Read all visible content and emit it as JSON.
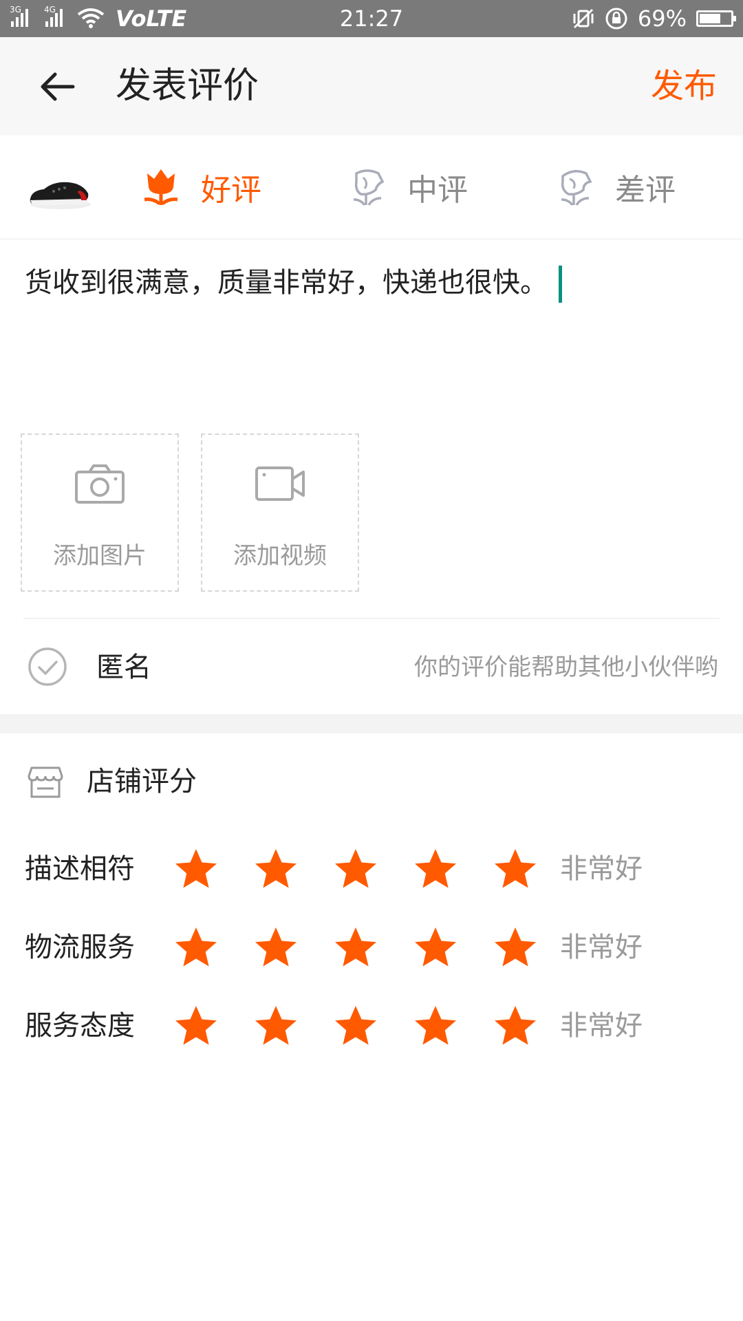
{
  "status_bar": {
    "net1": "3G",
    "net2": "4G",
    "volte": "VoLTE",
    "time": "21:27",
    "battery": "69%",
    "battery_level": 0.69
  },
  "header": {
    "title": "发表评价",
    "publish_label": "发布"
  },
  "rating_types": [
    {
      "label": "好评",
      "icon": "flower-icon",
      "selected": true
    },
    {
      "label": "中评",
      "icon": "neutral-flower-icon",
      "selected": false
    },
    {
      "label": "差评",
      "icon": "sad-flower-icon",
      "selected": false
    }
  ],
  "review": {
    "text": "货收到很满意，质量非常好，快递也很快。"
  },
  "uploads": {
    "photo_label": "添加图片",
    "video_label": "添加视频"
  },
  "anonymous": {
    "label": "匿名",
    "hint": "你的评价能帮助其他小伙伴哟"
  },
  "shop_rating": {
    "title": "店铺评分",
    "rows": [
      {
        "label": "描述相符",
        "stars": 5,
        "text": "非常好"
      },
      {
        "label": "物流服务",
        "stars": 5,
        "text": "非常好"
      },
      {
        "label": "服务态度",
        "stars": 5,
        "text": "非常好"
      }
    ]
  },
  "colors": {
    "accent": "#ff5a00",
    "muted": "#9a9a9a",
    "cursor": "#0a9080"
  }
}
